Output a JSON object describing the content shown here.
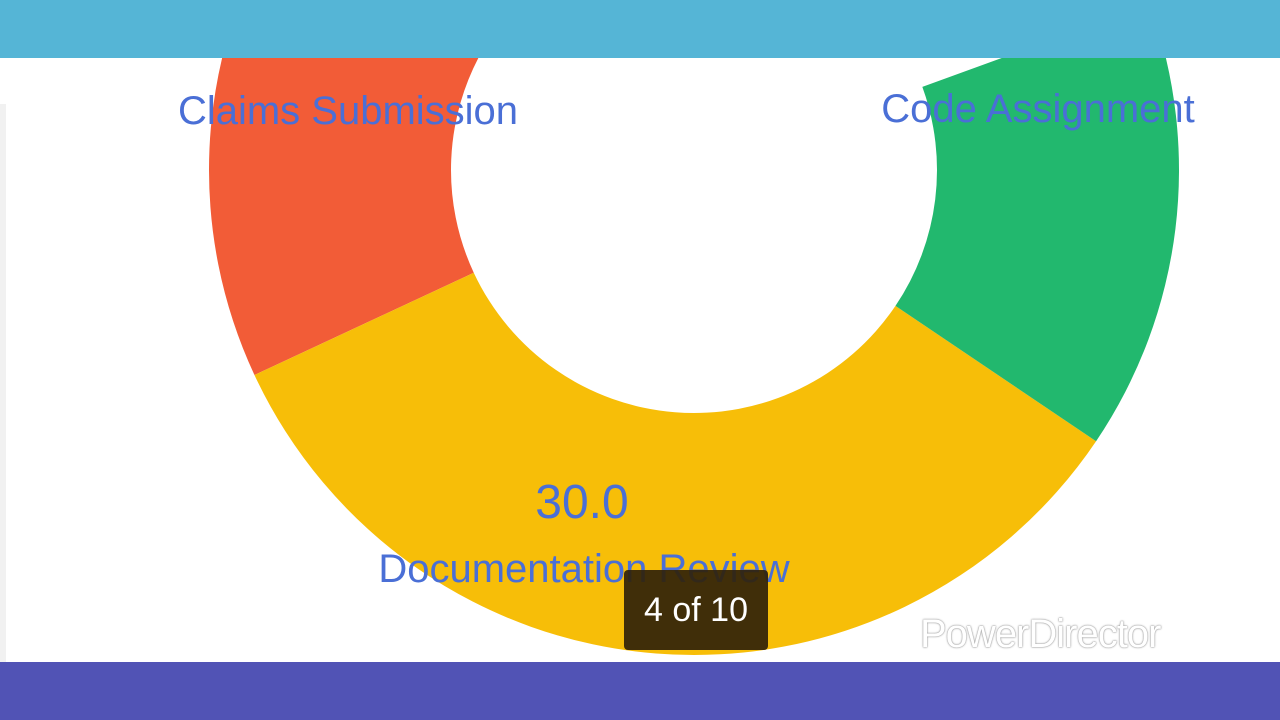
{
  "chart_data": {
    "type": "pie",
    "style": "donut",
    "slices": [
      {
        "label": "Claims Submission",
        "color": "#f25c37"
      },
      {
        "label": "Documentation Review",
        "value": 30.0,
        "value_text": "30.0",
        "color": "#f7be08"
      },
      {
        "label": "Code Assignment",
        "color": "#22b86e"
      }
    ]
  },
  "overlay": {
    "counter": "4 of 10",
    "watermark": "PowerDirector"
  },
  "colors": {
    "top_bar": "#55b5d6",
    "bottom_bar": "#5153b5",
    "label_text": "#4a6fd6"
  }
}
